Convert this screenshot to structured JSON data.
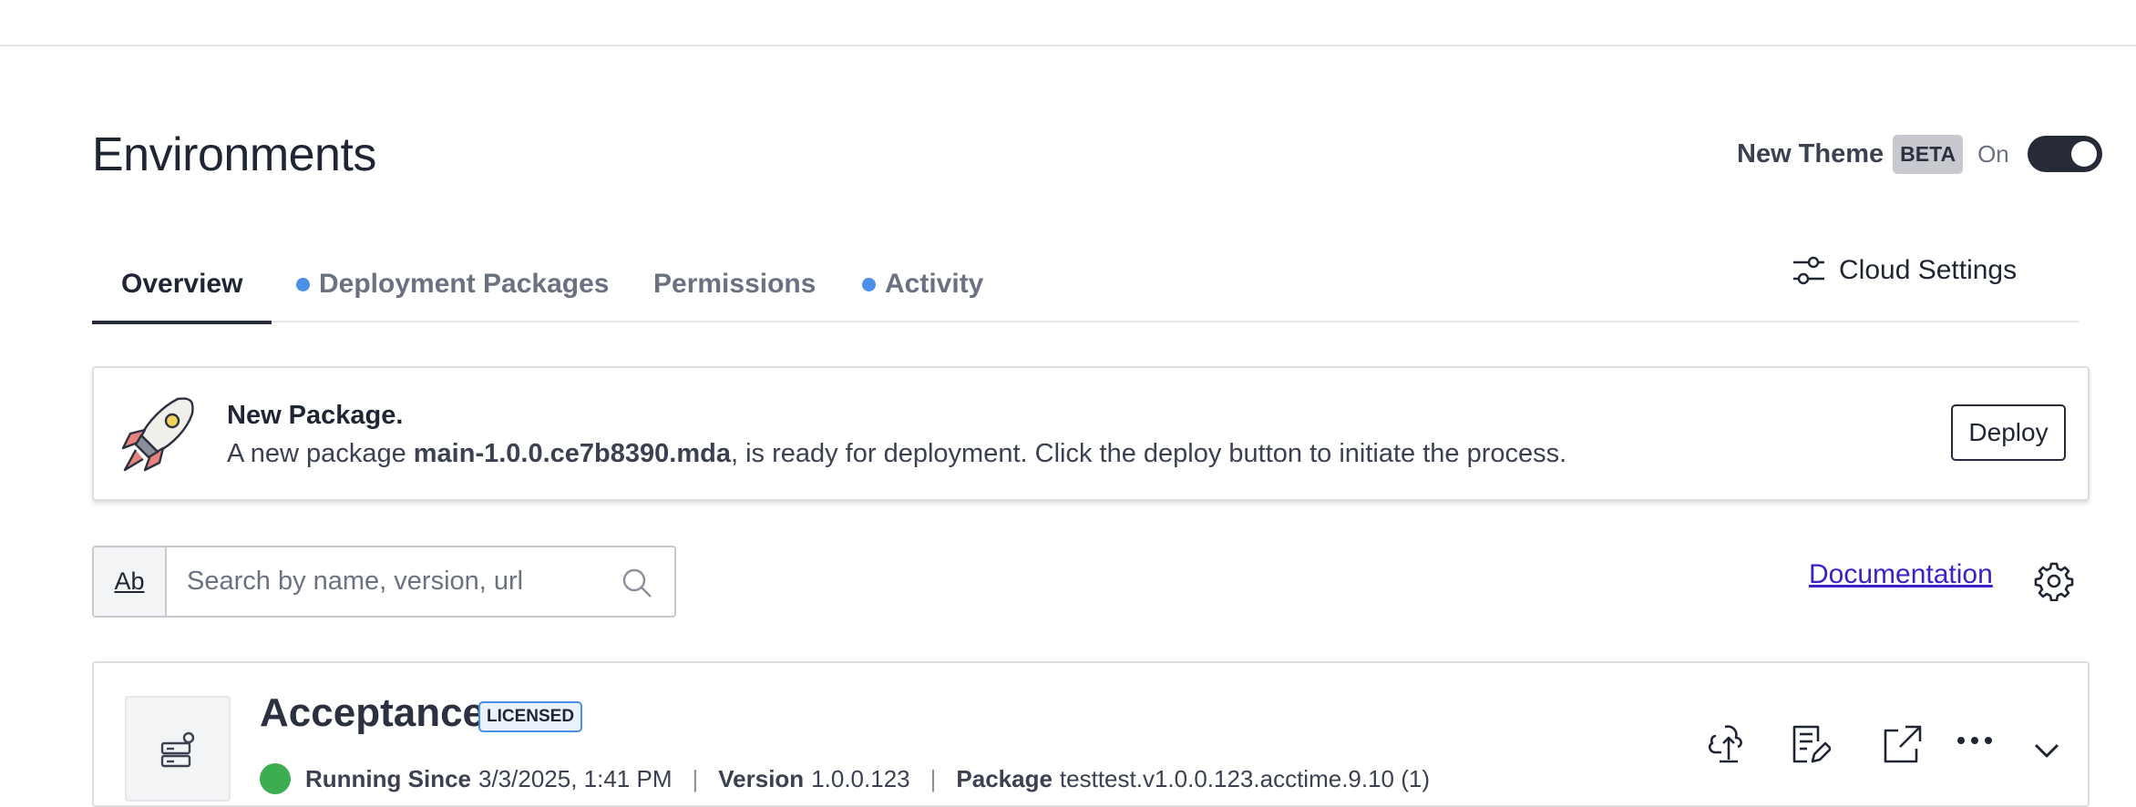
{
  "page": {
    "title": "Environments"
  },
  "theme": {
    "label": "New Theme",
    "badge": "BETA",
    "state": "On",
    "enabled": true
  },
  "tabs": [
    {
      "label": "Overview",
      "active": true,
      "dot": false
    },
    {
      "label": "Deployment Packages",
      "active": false,
      "dot": true
    },
    {
      "label": "Permissions",
      "active": false,
      "dot": false
    },
    {
      "label": "Activity",
      "active": false,
      "dot": true
    }
  ],
  "cloud_settings": {
    "label": "Cloud Settings",
    "icon": "sliders-icon"
  },
  "banner": {
    "title": "New Package.",
    "text_prefix": "A new package ",
    "package_name": "main-1.0.0.ce7b8390.mda",
    "text_suffix": ", is ready for deployment. Click the deploy button to initiate the process.",
    "button_label": "Deploy",
    "icon": "rocket-icon"
  },
  "search": {
    "mode_label": "Ab",
    "placeholder": "Search by name, version, url",
    "value": ""
  },
  "documentation": {
    "label": "Documentation"
  },
  "environment": {
    "name": "Acceptance",
    "badge": "LICENSED",
    "status": "Running Since",
    "since": "3/3/2025, 1:41 PM",
    "version_label": "Version",
    "version": "1.0.0.123",
    "package_label": "Package",
    "package": "testtest.v1.0.0.123.acctime.9.10 (1)",
    "status_color": "#3cae4f"
  }
}
